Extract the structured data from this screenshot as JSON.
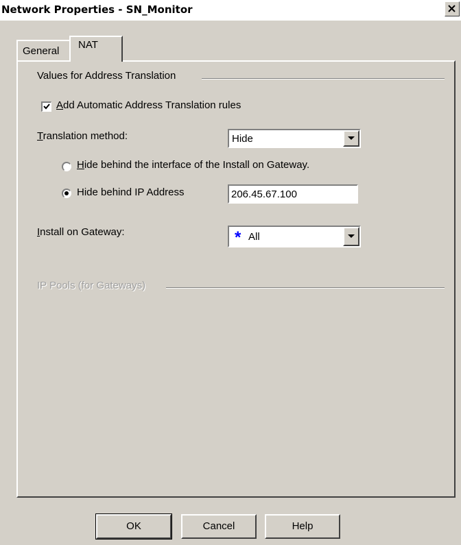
{
  "window": {
    "title": "Network Properties - SN_Monitor",
    "close_icon": "close-x-icon"
  },
  "tabs": [
    {
      "label": "General",
      "active": false
    },
    {
      "label": "NAT",
      "active": true
    }
  ],
  "nat": {
    "group_address_translation": "Values for Address Translation",
    "auto_rules": {
      "mnemonic": "A",
      "rest": "dd Automatic Address Translation rules",
      "checked": true
    },
    "translation_method": {
      "mnemonic": "T",
      "rest": "ranslation method:",
      "value": "Hide"
    },
    "radio_interface": {
      "mnemonic": "H",
      "rest": "ide behind the interface of the Install on Gateway.",
      "selected": false
    },
    "radio_ip": {
      "label": "Hide behind IP Address",
      "selected": true,
      "value": "206.45.67.100"
    },
    "install_on_gateway": {
      "mnemonic": "I",
      "rest": "nstall on Gateway:",
      "value": "All",
      "icon": "asterisk-icon",
      "icon_glyph": "*",
      "icon_color": "#0000ff"
    },
    "group_ip_pools": "IP Pools (for Gateways)"
  },
  "buttons": {
    "ok": "OK",
    "cancel": "Cancel",
    "help": "Help"
  }
}
